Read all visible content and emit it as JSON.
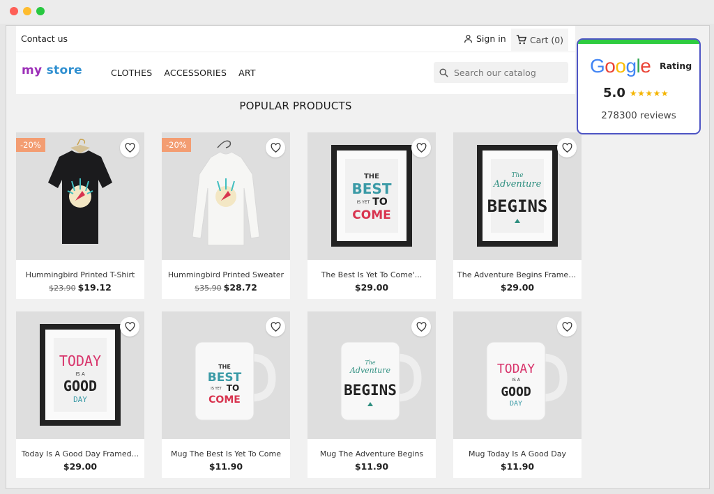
{
  "header": {
    "contact": "Contact us",
    "signin": "Sign in",
    "cart": "Cart (0)"
  },
  "logo": {
    "part1": "my",
    "part2": "store"
  },
  "menu": [
    {
      "label": "CLOTHES"
    },
    {
      "label": "ACCESSORIES"
    },
    {
      "label": "ART"
    }
  ],
  "search": {
    "placeholder": "Search our catalog"
  },
  "section_title": "POPULAR PRODUCTS",
  "products": [
    {
      "name": "Hummingbird Printed T-Shirt",
      "old_price": "$23.90",
      "price": "$19.12",
      "badge": "-20%"
    },
    {
      "name": "Hummingbird Printed Sweater",
      "old_price": "$35.90",
      "price": "$28.72",
      "badge": "-20%"
    },
    {
      "name": "The Best Is Yet To Come'...",
      "old_price": "",
      "price": "$29.00",
      "badge": ""
    },
    {
      "name": "The Adventure Begins Framed...",
      "old_price": "",
      "price": "$29.00",
      "badge": ""
    },
    {
      "name": "Today Is A Good Day Framed...",
      "old_price": "",
      "price": "$29.00",
      "badge": ""
    },
    {
      "name": "Mug The Best Is Yet To Come",
      "old_price": "",
      "price": "$11.90",
      "badge": ""
    },
    {
      "name": "Mug The Adventure Begins",
      "old_price": "",
      "price": "$11.90",
      "badge": ""
    },
    {
      "name": "Mug Today Is A Good Day",
      "old_price": "",
      "price": "$11.90",
      "badge": ""
    }
  ],
  "art_text": {
    "best": [
      "THE",
      "BEST",
      "IS YET",
      "TO",
      "COME"
    ],
    "adventure": [
      "The",
      "Adventure",
      "BEGINS"
    ],
    "today": [
      "TODAY",
      "IS A",
      "GOOD",
      "DAY"
    ]
  },
  "rating_widget": {
    "brand": "Google",
    "label": "Rating",
    "score": "5.0",
    "stars": "★★★★★",
    "stars_value": 5,
    "reviews": "278300 reviews"
  },
  "colors": {
    "badge": "#f39d72",
    "accent_green": "#2ecc40",
    "widget_border": "#4d54c4",
    "star": "#f4b400"
  }
}
